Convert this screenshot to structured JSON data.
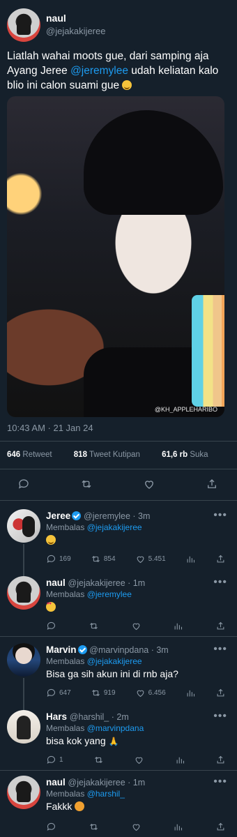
{
  "main": {
    "name": "naul",
    "handle": "@jejakakijeree",
    "text_part1": "Liatlah wahai moots gue, dari samping aja Ayang Jeree ",
    "mention": "@jeremylee",
    "text_part2": " udah keliatan kalo blio ini calon suami gue",
    "watermark": "@KH_APPLEHARIBO",
    "time": "10:43 AM · 21 Jan 24",
    "retweets_count": "646",
    "retweets_label": "Retweet",
    "quotes_count": "818",
    "quotes_label": "Tweet Kutipan",
    "likes_count": "61,6 rb",
    "likes_label": "Suka"
  },
  "replies": [
    {
      "name": "Jeree",
      "verified": true,
      "handle_time": "@jeremylee · 3m",
      "replying_prefix": "Membalas ",
      "replying_to": "@jejakakijeree",
      "text": "",
      "emoji": "blush",
      "replies": "169",
      "retweets": "854",
      "likes": "5.451"
    },
    {
      "name": "naul",
      "verified": false,
      "handle_time": "@jejakakijeree · 1m",
      "replying_prefix": "Membalas ",
      "replying_to": "@jeremylee",
      "text": "",
      "emoji": "heart-eyes",
      "replies": "",
      "retweets": "",
      "likes": ""
    },
    {
      "name": "Marvin",
      "verified": true,
      "handle_time": "@marvinpdana · 3m",
      "replying_prefix": "Membalas ",
      "replying_to": "@jejakakijeree",
      "text": "Bisa ga sih akun ini di rnb aja?",
      "replies": "647",
      "retweets": "919",
      "likes": "6.456"
    },
    {
      "name": "Hars",
      "verified": false,
      "handle_time": "@harshil_ · 2m",
      "replying_prefix": "Membalas ",
      "replying_to": "@marvinpdana",
      "text": "bisa kok yang",
      "emoji": "pray",
      "replies": "1",
      "retweets": "",
      "likes": ""
    },
    {
      "name": "naul",
      "verified": false,
      "handle_time": "@jejakakijeree · 1m",
      "replying_prefix": "Membalas ",
      "replying_to": "@harshil_",
      "text": "Fakkk",
      "emoji": "angry",
      "replies": "",
      "retweets": "",
      "likes": ""
    }
  ],
  "more_label": "•••",
  "colors": {
    "background": "#15202b",
    "accent": "#1d9bf0",
    "muted": "#8b98a5",
    "divider": "#38444d"
  }
}
